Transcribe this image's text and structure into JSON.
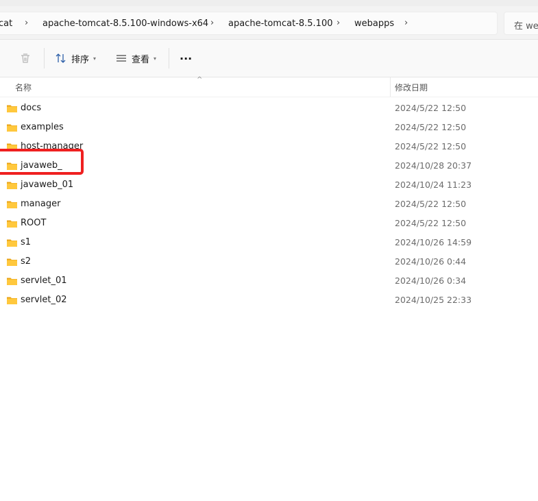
{
  "breadcrumbs": [
    {
      "label": "cat"
    },
    {
      "label": "apache-tomcat-8.5.100-windows-x64"
    },
    {
      "label": "apache-tomcat-8.5.100"
    },
    {
      "label": "webapps"
    }
  ],
  "search": {
    "placeholder": "在 we"
  },
  "toolbar": {
    "sort_label": "排序",
    "view_label": "查看",
    "more_label": "···"
  },
  "columns": {
    "name": "名称",
    "modified": "修改日期"
  },
  "files": [
    {
      "name": "docs",
      "modified": "2024/5/22 12:50"
    },
    {
      "name": "examples",
      "modified": "2024/5/22 12:50"
    },
    {
      "name": "host-manager",
      "modified": "2024/5/22 12:50"
    },
    {
      "name": "javaweb_",
      "modified": "2024/10/28 20:37"
    },
    {
      "name": "javaweb_01",
      "modified": "2024/10/24 11:23"
    },
    {
      "name": "manager",
      "modified": "2024/5/22 12:50"
    },
    {
      "name": "ROOT",
      "modified": "2024/5/22 12:50"
    },
    {
      "name": "s1",
      "modified": "2024/10/26 14:59"
    },
    {
      "name": "s2",
      "modified": "2024/10/26 0:44"
    },
    {
      "name": "servlet_01",
      "modified": "2024/10/26 0:34"
    },
    {
      "name": "servlet_02",
      "modified": "2024/10/25 22:33"
    }
  ],
  "colors": {
    "folder_back": "#e8a317",
    "folder_front": "#ffc83d",
    "highlight": "#ef2020"
  }
}
